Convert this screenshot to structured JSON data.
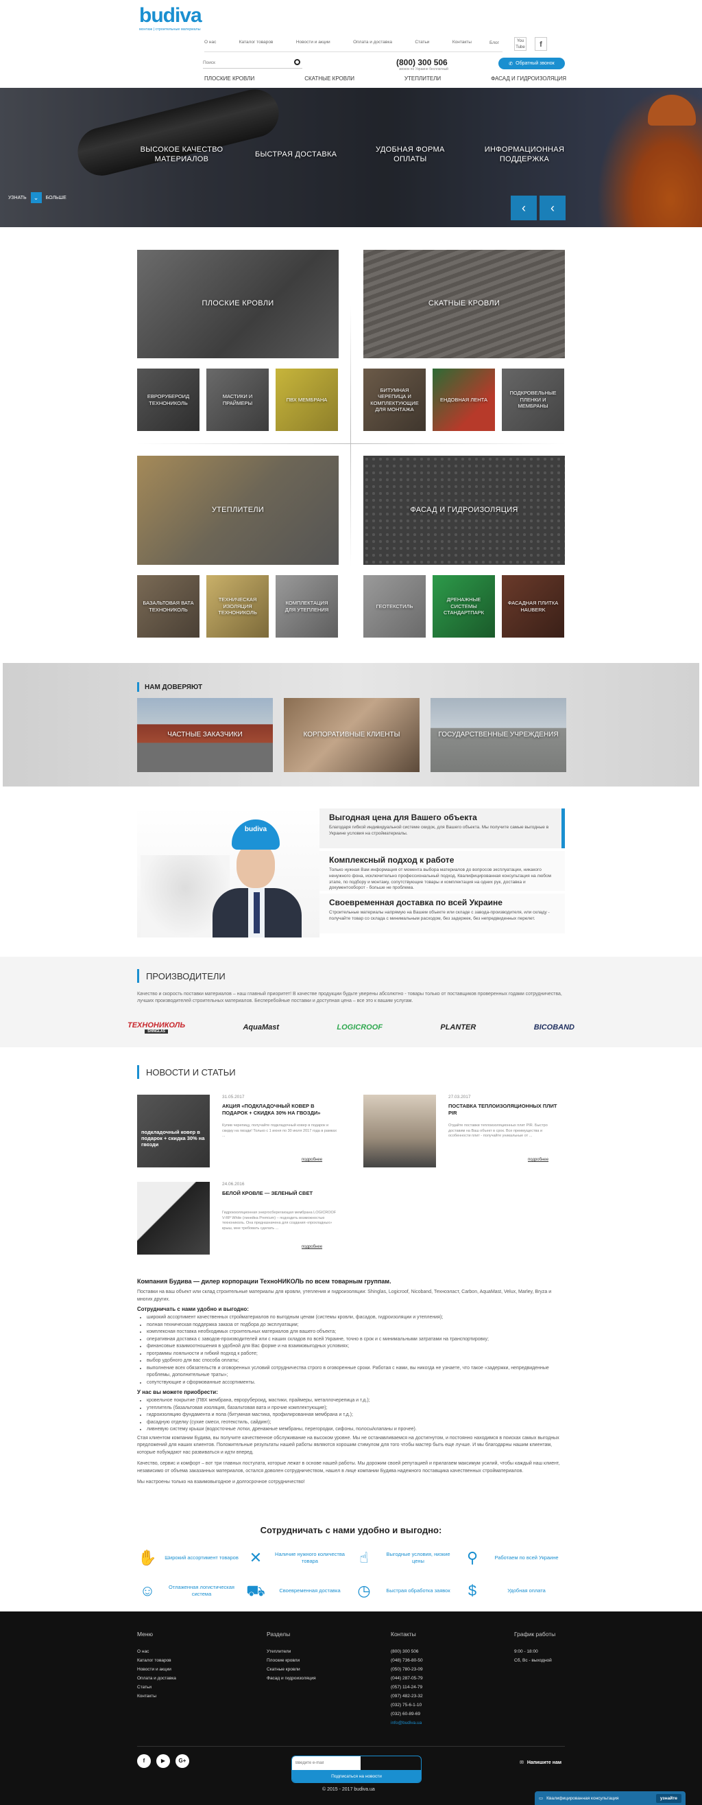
{
  "header": {
    "logo_text": "budiva",
    "logo_tagline": "монтаж | строительные материалы",
    "nav": [
      "О нас",
      "Каталог товаров",
      "Новости и акции",
      "Оплата и доставка",
      "Статьи",
      "Контакты"
    ],
    "blog": "Блог",
    "search_placeholder": "Поиск",
    "phone": "(800) 300 506",
    "phone_sub": "звонок по Украине бесплатный",
    "callback": "Обратный звонок",
    "cats": [
      "ПЛОСКИЕ КРОВЛИ",
      "СКАТНЫЕ КРОВЛИ",
      "УТЕПЛИТЕЛИ",
      "ФАСАД И ГИДРОИЗОЛЯЦИЯ"
    ]
  },
  "hero": {
    "features": [
      "ВЫСОКОЕ КАЧЕСТВО МАТЕРИАЛОВ",
      "БЫСТРАЯ ДОСТАВКА",
      "УДОБНАЯ ФОРМА ОПЛАТЫ",
      "ИНФОРМАЦИОННАЯ ПОДДЕРЖКА"
    ],
    "more_left": "УЗНАТЬ",
    "more_right": "БОЛЬШЕ"
  },
  "catalog": {
    "group1": {
      "big_left": "ПЛОСКИЕ КРОВЛИ",
      "big_right": "СКАТНЫЕ КРОВЛИ",
      "small_left": [
        "ЕВРОРУБЕРОИД ТЕХНОНИКОЛЬ",
        "МАСТИКИ И ПРАЙМЕРЫ",
        "ПВХ МЕМБРАНА"
      ],
      "small_right": [
        "БИТУМНАЯ ЧЕРЕПИЦА И КОМПЛЕКТУЮЩИЕ ДЛЯ МОНТАЖА",
        "ЕНДОВНАЯ ЛЕНТА",
        "ПОДКРОВЕЛЬНЫЕ ПЛЕНКИ И МЕМБРАНЫ"
      ]
    },
    "group2": {
      "big_left": "УТЕПЛИТЕЛИ",
      "big_right": "ФАСАД И ГИДРОИЗОЛЯЦИЯ",
      "small_left": [
        "БАЗАЛЬТОВАЯ ВАТА ТЕХНОНИКОЛЬ",
        "ТЕХНИЧЕСКАЯ ИЗОЛЯЦИЯ ТЕХНОНИКОЛЬ",
        "КОМПЛЕКТАЦИЯ ДЛЯ УТЕПЛЕНИЯ"
      ],
      "small_right": [
        "ГЕОТЕКСТИЛЬ",
        "ДРЕНАЖНЫЕ СИСТЕМЫ СТАНДАРТПАРК",
        "ФАСАДНАЯ ПЛИТКА HAUBERK"
      ]
    }
  },
  "trust": {
    "title": "НАМ ДОВЕРЯЮТ",
    "items": [
      "ЧАСТНЫЕ ЗАКАЗЧИКИ",
      "КОРПОРАТИВНЫЕ КЛИЕНТЫ",
      "ГОСУДАРСТВЕННЫЕ УЧРЕЖДЕНИЯ"
    ]
  },
  "benefits": {
    "helmet_logo": "budiva",
    "items": [
      {
        "title": "Выгодная цена для Вашего объекта",
        "text": "Благодаря гибкой индивидуальной системе скидок, для Вашего объекта. Мы получите самые выгодные в Украине условия на стройматериалы."
      },
      {
        "title": "Комплексный подход к работе",
        "text": "Только нужная Вам информация от момента выбора материалов до вопросов эксплуатации, никакого ненужного фона, исключительно профессиональный подход. Квалифицированная консультация на любом этапе, по подбору и монтажу, сопутствующие товары и комплектация на одних рук, доставка и документооборот - больше не проблема."
      },
      {
        "title": "Своевременная доставка по всей Украине",
        "text": "Строительные материалы напрямую на Вашем объекте или складе с завода-производителя, или складу - получайте товар со склада с минимальным расходом, без задержек, без непредвиденных перелет."
      }
    ]
  },
  "producers": {
    "title": "ПРОИЗВОДИТЕЛИ",
    "text": "Качество и скорость поставки материалов – наш главный приоритет! В качестве продукции будьте уверены абсолютно - товары только от поставщиков проверенных годами сотрудничества, лучших производителей строительных материалов. Бесперебойные поставки и доступная цена – все это к вашим услугам.",
    "logos": [
      "ТЕХНОНИКОЛЬ",
      "AquaMast",
      "LOGICROOF",
      "PLANTER",
      "BICOBAND"
    ],
    "logo_subs": [
      "SHINGLAS",
      "",
      "",
      "",
      ""
    ],
    "logo_colors": [
      "#c8282d",
      "#222222",
      "#2fa84f",
      "#222222",
      "#1f2f5f"
    ]
  },
  "news": {
    "title": "НОВОСТИ И СТАТЬИ",
    "more": "подробнее",
    "items": [
      {
        "date": "31.05.2017",
        "title": "АКЦИЯ «ПОДКЛАДОЧНЫЙ КОВЕР В ПОДАРОК + СКИДКА 30% НА ГВОЗДИ»",
        "text": "Купив черепицу, получайте подкладочный ковер в подарок и скидку на гвозди! Только с 1 июня по 30 июля 2017 года в рамках ...",
        "img_text": "подкладочный ковер в подарок + скидка 30% на гвозди"
      },
      {
        "date": "27.03.2017",
        "title": "ПОСТАВКА ТЕПЛОИЗОЛЯЦИОННЫХ ПЛИТ PIR",
        "text": "Отдайте поставки теплоизоляционных плит PIR. Быстро доставим на Ваш объект в срок. Все преимущества и особенности плит - получайте уникальные от ...",
        "img_text": ""
      },
      {
        "date": "24.06.2016",
        "title": "БЕЛОЙ КРОВЛЕ — ЗЕЛЕНЫЙ СВЕТ",
        "text": "Гидроизоляционная энергосберегающая мембрана LOGICROOF V-RP White (линейка Premium) – подходить возможностью технониколь. Она предназначена для создания «прохладных» крыш, мне требовать сделать ...",
        "img_text": ""
      }
    ]
  },
  "about": {
    "title": "Компания Будива — дилер корпорации ТехноНИКОЛЬ по всем товарным группам.",
    "intro": "Поставки на ваш объект или склад строительные материалы для кровли, утепления и гидроизоляции: Shinglas, Logicroof, Nicoband, Техноэласт, Carbon, AquaMast, Velux, Marley, Bryza и многих других.",
    "h_conv": "Сотрудничать с нами удобно и выгодно:",
    "conv_list": [
      "широкий ассортимент качественных стройматериалов по выгодным ценам (системы кровли, фасадов, гидроизоляции и утепления);",
      "полная техническая поддержка заказа от подбора до эксплуатации;",
      "комплексная поставка необходимых строительных материалов для вашего объекта;",
      "оперативная доставка с заводов-производителей или с наших складов по всей Украине, точно в срок и с минимальными затратами на транспортировку;",
      "финансовые взаимоотношения в удобной для Вас форме и на взаимовыгодных условиях;",
      "программы лояльности и гибкий подход к работе;",
      "выбор удобного для вас способа оплаты;",
      "выполнение всех обязательств и оговоренных условий сотрудничества строго в оговоренные сроки. Работая с нами, вы никогда не узнаете, что такое «задержки, непредвиденные проблемы, дополнительные траты»;",
      "сопутствующие и сформованные ассортименты."
    ],
    "h_buy": "У нас вы можете приобрести:",
    "buy_list": [
      "кровельное покрытие (ПВХ мембрана, еврорубероид, мастики, праймеры, металлочерепица и т.д.);",
      "утеплитель (базальтовая изоляция, базальтовая вата и прочие комплектующие);",
      "гидроизоляцию фундамента и пола (битумная мастика, профилированная мембрана и т.д.);",
      "фасадную отделку (сухие смеси, геотекстиль, сайдинг);",
      "ливневую систему крыши (водосточные лотки, дренажные мембраны, перегородки, сифоны, полосы/клапаны и прочее)."
    ],
    "p1": "Стая клиентом компании Будива, вы получите качественное обслуживание на высоком уровне. Мы не останавливаемся на достигнутом, и постоянно находимся в поисках самых выгодных предложений для наших клиентов. Положительные результаты нашей работы являются хорошим стимулом для того чтобы мастер быть еще лучше. И мы благодарны нашим клиентам, которые побуждают нас развиваться и идти вперед.",
    "p2": "Качество, сервис и комфорт – вот три главных постулата, которые лежат в основе нашей работы. Мы дорожим своей репутацией и прилагаем максимум усилий, чтобы каждый наш клиент, независимо от объема заказанных материалов, остался доволен сотрудничеством, нашел в лице компании Будива надежного поставщика качественных стройматериалов.",
    "p3": "Мы настроены только на взаимовыгодное и долгосрочное сотрудничество!"
  },
  "advantages": {
    "title": "Сотрудничать с нами удобно и выгодно:",
    "items": [
      {
        "label": "Широкий ассортимент товаров",
        "icon": "handshake-icon",
        "glyph": "✋"
      },
      {
        "label": "Наличие нужного количества товара",
        "icon": "tools-icon",
        "glyph": "✕"
      },
      {
        "label": "Выгодные условия, низкие цены",
        "icon": "hand-money-icon",
        "glyph": "☝"
      },
      {
        "label": "Работаем по всей Украине",
        "icon": "map-pin-icon",
        "glyph": "⚲"
      },
      {
        "label": "Отлаженная логистическая система",
        "icon": "worker-icon",
        "glyph": "☺"
      },
      {
        "label": "Своевременная доставка",
        "icon": "truck-icon",
        "glyph": "⛟"
      },
      {
        "label": "Быстрая обработка заявок",
        "icon": "clock-icon",
        "glyph": "◷"
      },
      {
        "label": "Удобная оплата",
        "icon": "wallet-icon",
        "glyph": "$"
      }
    ]
  },
  "footer": {
    "menu_title": "Меню",
    "menu": [
      "О нас",
      "Каталог товаров",
      "Новости и акции",
      "Оплата и доставка",
      "Статьи",
      "Контакты"
    ],
    "sections_title": "Разделы",
    "sections": [
      "Утеплители",
      "Плоские кровли",
      "Скатные кровли",
      "Фасад и гидроизоляция"
    ],
    "contacts_title": "Контакты",
    "contacts": [
      "(800) 300 506",
      "(048) 736-80-50",
      "(050) 780-23-09",
      "(044) 287-05-79",
      "(057) 114-24-79",
      "(097) 482-23-32",
      "(032) 75-6-1-10",
      "(032) 60-89-69",
      "info@budiva.ua"
    ],
    "hours_title": "График работы",
    "hours": [
      "9:00 - 18:00",
      "Сб, Вс - выходной"
    ],
    "subscribe_placeholder": "Введите e-mail",
    "subscribe_btn": "Подписаться на новости",
    "social": [
      "f",
      "▶",
      "G+"
    ],
    "write_us": "Напишите нам",
    "copyright": "© 2015 - 2017 budiva.ua",
    "chat_text": "Квалифицированная консультация",
    "chat_btn": "узнайте"
  }
}
